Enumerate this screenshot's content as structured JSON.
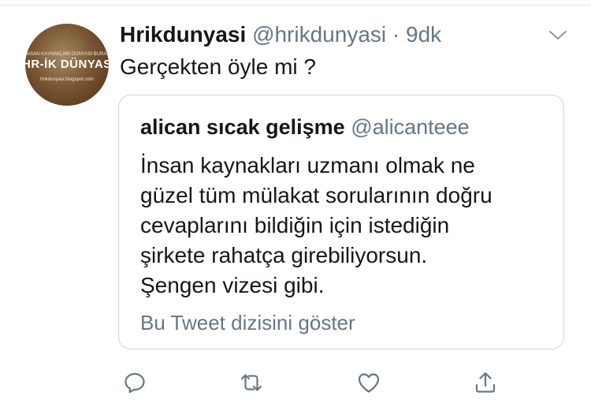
{
  "avatar": {
    "top_text": "İNSAN KAYNAKLARI DÜNYASI BURADA",
    "brand": "HR-İK DÜNYASI",
    "url": "hrikdunyasi.blogspot.com"
  },
  "tweet": {
    "display_name": "Hrikdunyasi",
    "handle": "@hrikdunyasi",
    "separator": "·",
    "timestamp": "9dk",
    "text": "Gerçekten öyle mi ?"
  },
  "quote": {
    "display_name": "alican sıcak gelişme",
    "handle": "@alicanteee",
    "lines": [
      "İnsan kaynakları uzmanı olmak ne",
      "güzel tüm mülakat sorularının doğru",
      "cevaplarını bildiğin için istediğin",
      "şirkete rahatça girebiliyorsun.",
      "Şengen vizesi gibi."
    ],
    "show_thread": "Bu Tweet dizisini göster"
  },
  "icons": {
    "menu": "chevron-down-icon",
    "reply": "reply-icon",
    "retweet": "retweet-icon",
    "like": "heart-icon",
    "share": "share-icon"
  },
  "colors": {
    "text": "#14171a",
    "secondary": "#657786",
    "border": "#ccd6dd"
  }
}
